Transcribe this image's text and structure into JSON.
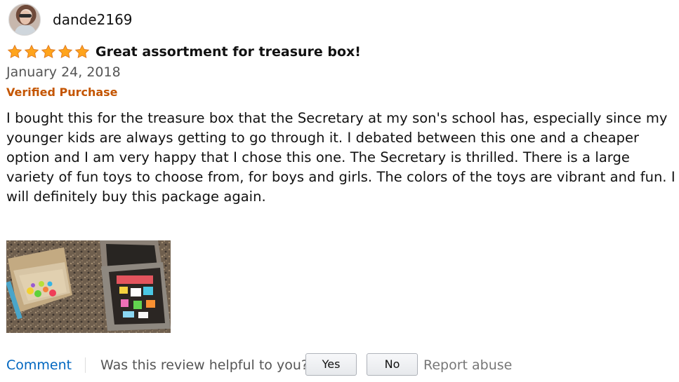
{
  "review": {
    "user": {
      "name": "dande2169"
    },
    "rating": {
      "value": 5,
      "max": 5,
      "icon": "star-icon"
    },
    "title": "Great assortment for treasure box!",
    "date": "January 24, 2018",
    "verified_label": "Verified Purchase",
    "body": "I bought this for the treasure box that the Secretary at my son's school has, especially since my younger kids are always getting to go through it. I debated between this one and a cheaper option and I am very happy that I chose this one. The Secretary is thrilled. There is a large variety of fun toys to choose from, for boys and girls. The colors of the toys are vibrant and fun. I will definitely buy this package again."
  },
  "actions": {
    "comment_label": "Comment",
    "helpful_question": "Was this review helpful to you?",
    "yes_label": "Yes",
    "no_label": "No",
    "report_label": "Report abuse"
  },
  "colors": {
    "star": "#ffa41c",
    "verified": "#c45500",
    "link": "#0066c0",
    "muted_text": "#555555"
  }
}
